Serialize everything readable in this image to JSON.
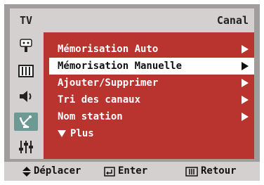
{
  "header": {
    "source": "TV",
    "title": "Canal"
  },
  "menu": {
    "items": [
      {
        "label": "Mémorisation Auto",
        "has_submenu": true,
        "selected": false
      },
      {
        "label": "Mémorisation Manuelle",
        "has_submenu": true,
        "selected": true
      },
      {
        "label": "Ajouter/Supprimer",
        "has_submenu": true,
        "selected": false
      },
      {
        "label": "Tri des canaux",
        "has_submenu": true,
        "selected": false
      },
      {
        "label": "Nom station",
        "has_submenu": true,
        "selected": false
      }
    ],
    "more_label": "Plus"
  },
  "sidebar": {
    "icons": [
      "input-icon",
      "picture-icon",
      "sound-icon",
      "channel-icon",
      "setup-icon"
    ],
    "active": "channel-icon"
  },
  "footer": {
    "move_label": "Déplacer",
    "enter_label": "Enter",
    "return_label": "Retour"
  },
  "colors": {
    "frame": "#a29d9d",
    "panel": "#d4d0d0",
    "menu_bg": "#b9342e",
    "selected_bg": "#ffffff",
    "active_icon_bg": "#6e9a95"
  }
}
